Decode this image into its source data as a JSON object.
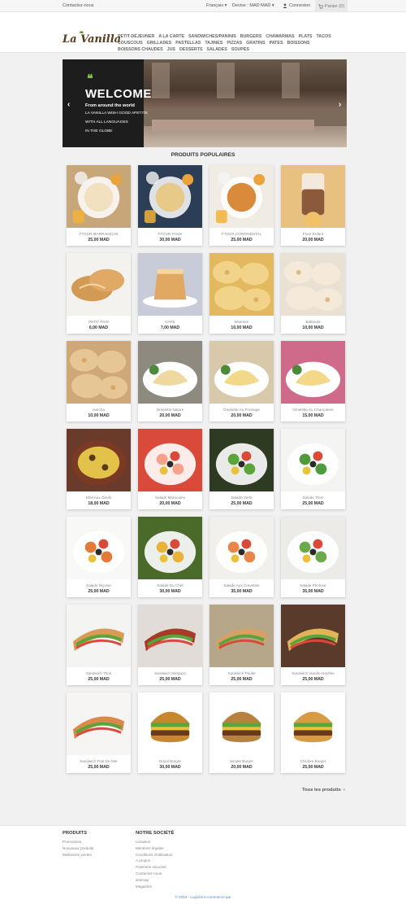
{
  "topbar": {
    "contact": "Contactez-nous",
    "language": "Français",
    "currency_label": "Devise :",
    "currency_value": "MAD MAD",
    "login": "Connexion",
    "cart": "Panier (0)"
  },
  "header": {
    "logo": "La Vanilla",
    "nav": [
      "PETIT-DÉJEUNER",
      "A LA CARTE",
      "SANDWICHES/PANINIS",
      "BURGERS",
      "CHAWARMAS",
      "PLATS",
      "TACOS",
      "COUSCOUS",
      "GRILLADES",
      "PASTELLAS",
      "TAJINES",
      "PIZZAS",
      "GRATINS",
      "PATES",
      "BOISSONS",
      "BOISSONS CHAUDES",
      "JUS",
      "DESSERTS",
      "SALADES",
      "SOUPES"
    ]
  },
  "slider": {
    "quote": "❝",
    "title": "WELCOME",
    "line1": "From around the world",
    "line2": "LA VANILLA WISH GOOD APETITE",
    "line3": "WITH ALL LANGUAGES",
    "line4": "IN THE GLOBE",
    "prev": "‹",
    "next": "›"
  },
  "section_title": "PRODUITS POPULAIRES",
  "products": [
    {
      "name": "FTOUR MARRAKECHI",
      "price": "25,00 MAD",
      "icon": "breakfast-plate",
      "bg": "#c7a77a",
      "fg": "#f1e1c1"
    },
    {
      "name": "FTOUR FASSI",
      "price": "30,00 MAD",
      "icon": "breakfast-plate",
      "bg": "#2b3e55",
      "fg": "#e7c98a"
    },
    {
      "name": "FTOUR CONTINENTAL",
      "price": "25,00 MAD",
      "icon": "breakfast-plate",
      "bg": "#f0ece4",
      "fg": "#d98a3a"
    },
    {
      "name": "Ftour Enfant",
      "price": "20,00 MAD",
      "icon": "drink-glass",
      "bg": "#e8c080",
      "fg": "#8a5a3a"
    },
    {
      "name": "PETIT PAIN",
      "price": "6,00 MAD",
      "icon": "bread",
      "bg": "#f4f2ef",
      "fg": "#d29a55"
    },
    {
      "name": "CAKE",
      "price": "7,00 MAD",
      "icon": "cake",
      "bg": "#c8ccd8",
      "fg": "#e0a860"
    },
    {
      "name": "Msemen",
      "price": "10,00 MAD",
      "icon": "flatbread",
      "bg": "#e2b95e",
      "fg": "#f1d48a"
    },
    {
      "name": "Batbouts",
      "price": "10,00 MAD",
      "icon": "flatbread",
      "bg": "#e9e1d4",
      "fg": "#f5ead9"
    },
    {
      "name": "Harcha",
      "price": "10,00 MAD",
      "icon": "flatbread",
      "bg": "#cfa878",
      "fg": "#e7c696"
    },
    {
      "name": "Omelette Nature",
      "price": "20,00 MAD",
      "icon": "omelette",
      "bg": "#8e8a80",
      "fg": "#f0d9a0"
    },
    {
      "name": "Omelette Au Fromage",
      "price": "20,00 MAD",
      "icon": "omelette",
      "bg": "#d8c9aa",
      "fg": "#f2d98a"
    },
    {
      "name": "Omelette Au Charcuterie",
      "price": "15,00 MAD",
      "icon": "omelette",
      "bg": "#d06a8a",
      "fg": "#f2d888"
    },
    {
      "name": "Kfeli Aux Oeufs",
      "price": "18,00 MAD",
      "icon": "tagine-dish",
      "bg": "#6a3a2a",
      "fg": "#e3c24a"
    },
    {
      "name": "Salade Marocaine",
      "price": "20,00 MAD",
      "icon": "salad-bowl",
      "bg": "#d94a3a",
      "fg": "#f6a28a"
    },
    {
      "name": "Salade Verte",
      "price": "25,00 MAD",
      "icon": "salad-bowl",
      "bg": "#2e3a22",
      "fg": "#5aa43a"
    },
    {
      "name": "Salade Thon",
      "price": "25,00 MAD",
      "icon": "salad-bowl",
      "bg": "#f4f4f2",
      "fg": "#4f9a3a"
    },
    {
      "name": "Salade Niçoise",
      "price": "25,00 MAD",
      "icon": "salad-bowl",
      "bg": "#f8f8f6",
      "fg": "#e27a3a"
    },
    {
      "name": "Salade Du Chef",
      "price": "30,00 MAD",
      "icon": "salad-bowl",
      "bg": "#4a6a2a",
      "fg": "#e9b23a"
    },
    {
      "name": "Salade Aux Crevettes",
      "price": "35,00 MAD",
      "icon": "salad-bowl",
      "bg": "#f2f0ec",
      "fg": "#e8864a"
    },
    {
      "name": "Salade Pêcheur",
      "price": "35,00 MAD",
      "icon": "salad-bowl",
      "bg": "#ecebe7",
      "fg": "#6aaa4a"
    },
    {
      "name": "Sandwich Thon",
      "price": "25,00 MAD",
      "icon": "sandwich",
      "bg": "#f4f4f2",
      "fg": "#d99a55"
    },
    {
      "name": "Sandwich Merguez",
      "price": "25,00 MAD",
      "icon": "sandwich",
      "bg": "#e2dcd8",
      "fg": "#a83a2a"
    },
    {
      "name": "Sandwich Poulet",
      "price": "25,00 MAD",
      "icon": "sandwich",
      "bg": "#b6a68a",
      "fg": "#d9a066"
    },
    {
      "name": "Sandwich Viande Hachée",
      "price": "25,00 MAD",
      "icon": "sandwich",
      "bg": "#5a3a2a",
      "fg": "#e2b45a"
    },
    {
      "name": "Sandwich Fruit De Mer",
      "price": "25,00 MAD",
      "icon": "sandwich",
      "bg": "#f6f5f3",
      "fg": "#d98a4a"
    },
    {
      "name": "Royal Burger",
      "price": "30,00 MAD",
      "icon": "burger",
      "bg": "#ffffff",
      "fg": "#c8862e"
    },
    {
      "name": "Simple Burger",
      "price": "20,00 MAD",
      "icon": "burger",
      "bg": "#ffffff",
      "fg": "#b8823e"
    },
    {
      "name": "Chicken Burger",
      "price": "25,00 MAD",
      "icon": "burger",
      "bg": "#ffffff",
      "fg": "#d89a42"
    }
  ],
  "all_products": "Tous les produits",
  "footer": {
    "col1_title": "PRODUITS",
    "col1_links": [
      "Promotions",
      "Nouveaux produits",
      "Meilleures ventes"
    ],
    "col2_title": "NOTRE SOCIÉTÉ",
    "col2_links": [
      "Livraison",
      "Mentions légales",
      "Conditions d'utilisation",
      "A propos",
      "Paiement sécurisé",
      "Contactez-nous",
      "sitemap",
      "Magasins"
    ],
    "copyright": "© 2023 - Logiciel e-commerce par"
  }
}
